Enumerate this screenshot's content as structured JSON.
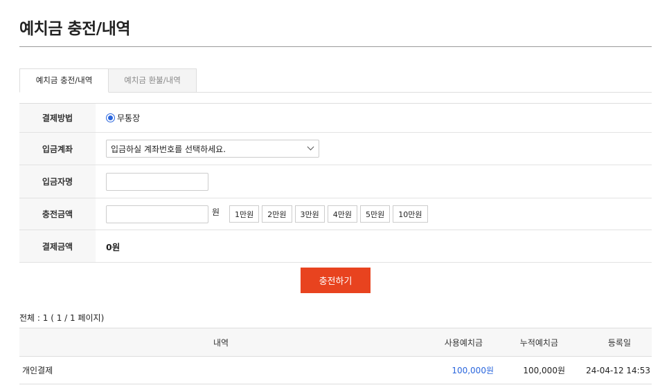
{
  "page_title": "예치금 충전/내역",
  "tabs": [
    {
      "label": "예치금 충전/내역",
      "active": true
    },
    {
      "label": "예치금 환불/내역",
      "active": false
    }
  ],
  "form": {
    "payment_method": {
      "label": "결제방법",
      "option": "무통장"
    },
    "deposit_account": {
      "label": "입금계좌",
      "placeholder": "입금하실 계좌번호를 선택하세요."
    },
    "depositor_name": {
      "label": "입금자명",
      "value": ""
    },
    "charge_amount": {
      "label": "충전금액",
      "value": "",
      "unit": "원",
      "quick_buttons": [
        "1만원",
        "2만원",
        "3만원",
        "4만원",
        "5만원",
        "10만원"
      ]
    },
    "payment_amount": {
      "label": "결제금액",
      "value": "0원"
    }
  },
  "charge_button": "충전하기",
  "total_text": "전체 : 1 ( 1 / 1 페이지)",
  "table": {
    "headers": [
      "내역",
      "사용예치금",
      "누적예치금",
      "등록일"
    ],
    "rows": [
      {
        "desc": "개인결제",
        "used": "100,000원",
        "accumulated": "100,000원",
        "date": "24-04-12 14:53"
      }
    ]
  },
  "colors": {
    "accent": "#e8431f",
    "link_blue": "#2a66dd"
  }
}
